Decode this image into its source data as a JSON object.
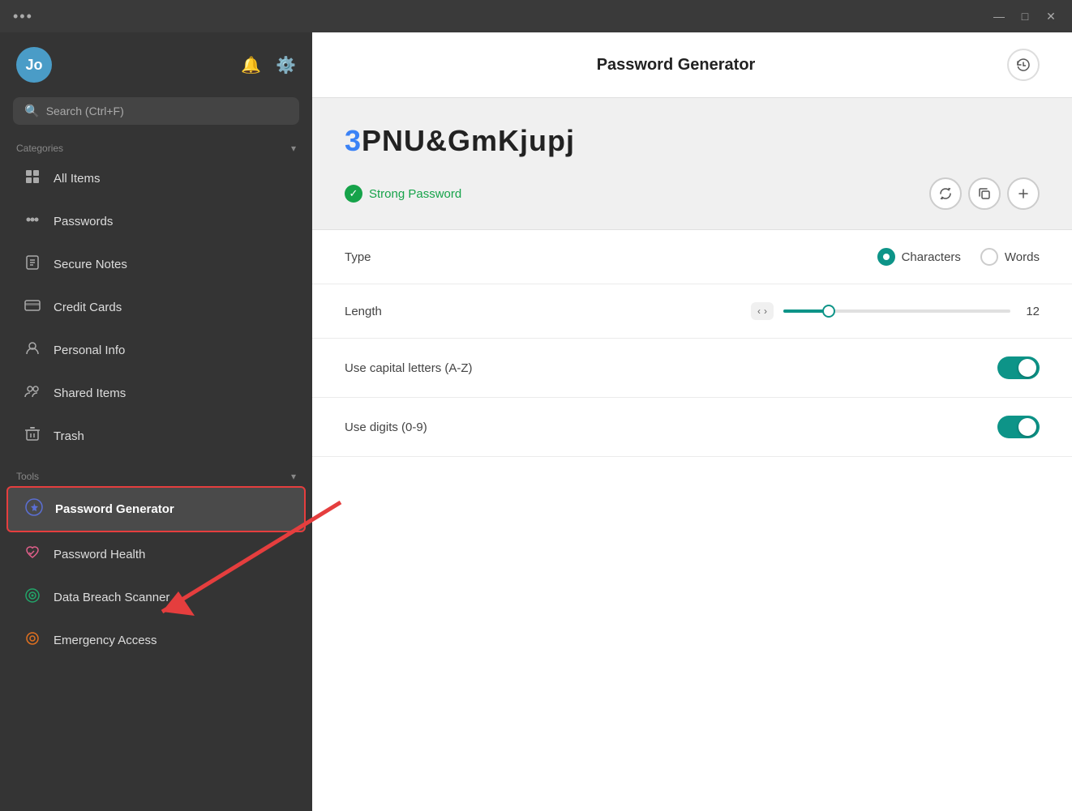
{
  "titlebar": {
    "dots": "•••",
    "minimize": "—",
    "maximize": "□",
    "close": "✕"
  },
  "sidebar": {
    "avatar_initials": "Jo",
    "search_placeholder": "Search (Ctrl+F)",
    "categories_label": "Categories",
    "tools_label": "Tools",
    "nav_items_categories": [
      {
        "id": "all-items",
        "label": "All Items",
        "icon": "grid"
      },
      {
        "id": "passwords",
        "label": "Passwords",
        "icon": "dots"
      },
      {
        "id": "secure-notes",
        "label": "Secure Notes",
        "icon": "note"
      },
      {
        "id": "credit-cards",
        "label": "Credit Cards",
        "icon": "card"
      },
      {
        "id": "personal-info",
        "label": "Personal Info",
        "icon": "person"
      },
      {
        "id": "shared-items",
        "label": "Shared Items",
        "icon": "people"
      },
      {
        "id": "trash",
        "label": "Trash",
        "icon": "trash"
      }
    ],
    "nav_items_tools": [
      {
        "id": "password-generator",
        "label": "Password Generator",
        "icon": "star-circle",
        "active": true
      },
      {
        "id": "password-health",
        "label": "Password Health",
        "icon": "heart"
      },
      {
        "id": "data-breach",
        "label": "Data Breach Scanner",
        "icon": "target"
      },
      {
        "id": "emergency-access",
        "label": "Emergency Access",
        "icon": "ring"
      }
    ]
  },
  "content": {
    "title": "Password Generator",
    "generated_password_prefix": "3",
    "generated_password_main": "PNU&GmKjupj",
    "strength_label": "Strong Password",
    "type_label": "Type",
    "type_options": [
      {
        "id": "characters",
        "label": "Characters",
        "selected": true
      },
      {
        "id": "words",
        "label": "Words",
        "selected": false
      }
    ],
    "length_label": "Length",
    "length_value": "12",
    "capital_letters_label": "Use capital letters (A-Z)",
    "digits_label": "Use digits (0-9)"
  }
}
